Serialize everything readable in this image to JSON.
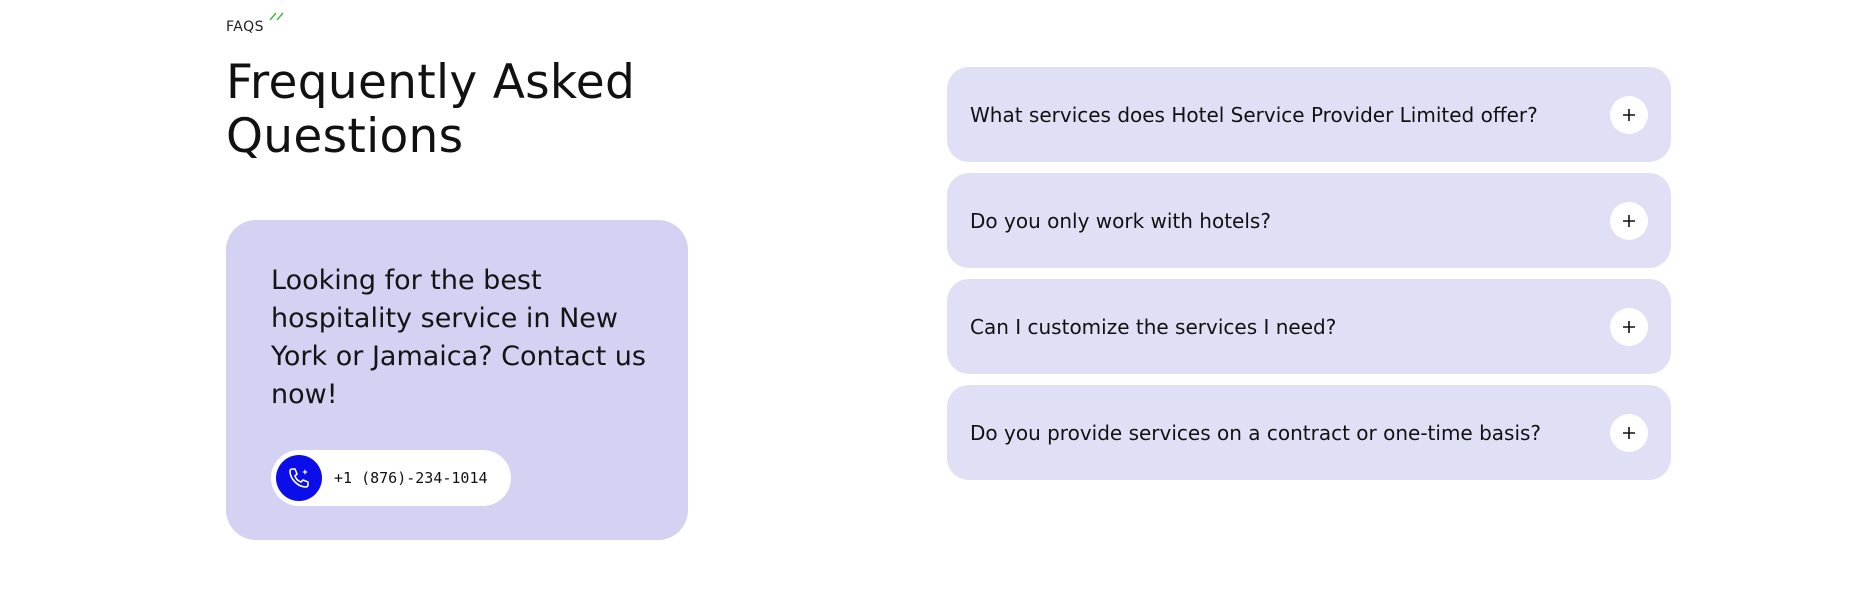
{
  "section": {
    "eyebrow": "FAQS",
    "title_line1": "Frequently Asked",
    "title_line2": "Questions"
  },
  "contact": {
    "text": "Looking for the best hospitality service in New York or Jamaica? Contact us now!",
    "phone": "+1 (876)-234-1014",
    "icon": "phone-icon"
  },
  "faqs": [
    {
      "question": "What services does Hotel Service Provider Limited offer?",
      "icon": "plus-icon"
    },
    {
      "question": "Do you only work with hotels?",
      "icon": "plus-icon"
    },
    {
      "question": "Can I customize the services I need?",
      "icon": "plus-icon"
    },
    {
      "question": "Do you provide services on a contract or one-time basis?",
      "icon": "plus-icon"
    }
  ],
  "colors": {
    "accent": "#0b0ee8",
    "contact_card": "#d3d2f3",
    "faq_card": "#dfe0f5",
    "eyebrow_mark": "#3fb83f"
  }
}
